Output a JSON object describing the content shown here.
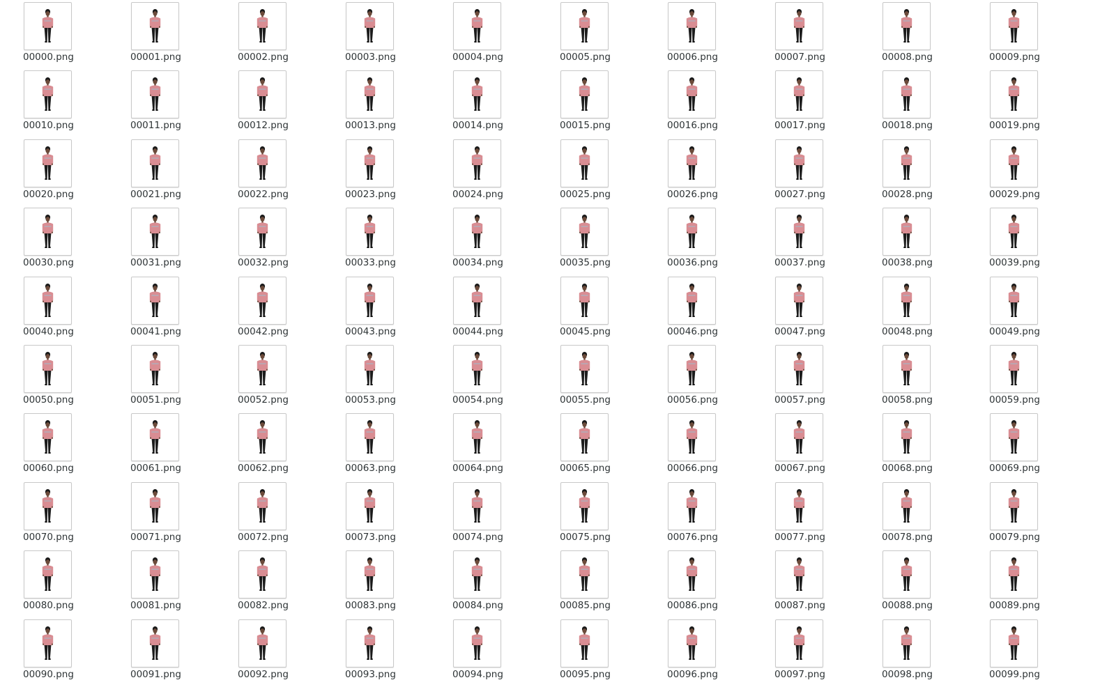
{
  "files": [
    "00000.png",
    "00001.png",
    "00002.png",
    "00003.png",
    "00004.png",
    "00005.png",
    "00006.png",
    "00007.png",
    "00008.png",
    "00009.png",
    "00010.png",
    "00011.png",
    "00012.png",
    "00013.png",
    "00014.png",
    "00015.png",
    "00016.png",
    "00017.png",
    "00018.png",
    "00019.png",
    "00020.png",
    "00021.png",
    "00022.png",
    "00023.png",
    "00024.png",
    "00025.png",
    "00026.png",
    "00027.png",
    "00028.png",
    "00029.png",
    "00030.png",
    "00031.png",
    "00032.png",
    "00033.png",
    "00034.png",
    "00035.png",
    "00036.png",
    "00037.png",
    "00038.png",
    "00039.png",
    "00040.png",
    "00041.png",
    "00042.png",
    "00043.png",
    "00044.png",
    "00045.png",
    "00046.png",
    "00047.png",
    "00048.png",
    "00049.png",
    "00050.png",
    "00051.png",
    "00052.png",
    "00053.png",
    "00054.png",
    "00055.png",
    "00056.png",
    "00057.png",
    "00058.png",
    "00059.png",
    "00060.png",
    "00061.png",
    "00062.png",
    "00063.png",
    "00064.png",
    "00065.png",
    "00066.png",
    "00067.png",
    "00068.png",
    "00069.png",
    "00070.png",
    "00071.png",
    "00072.png",
    "00073.png",
    "00074.png",
    "00075.png",
    "00076.png",
    "00077.png",
    "00078.png",
    "00079.png",
    "00080.png",
    "00081.png",
    "00082.png",
    "00083.png",
    "00084.png",
    "00085.png",
    "00086.png",
    "00087.png",
    "00088.png",
    "00089.png",
    "00090.png",
    "00091.png",
    "00092.png",
    "00093.png",
    "00094.png",
    "00095.png",
    "00096.png",
    "00097.png",
    "00098.png",
    "00099.png"
  ],
  "thumbnail": {
    "icon": "person-thumbnail-icon",
    "colors": {
      "shirt": "#d98d93",
      "pants": "#1c1c1c",
      "skin": "#6b4a3a",
      "hair": "#1a1a1a"
    }
  },
  "colors": {
    "background": "#ffffff",
    "label_text": "#2e3436",
    "thumb_border": "#c8c8c8"
  }
}
